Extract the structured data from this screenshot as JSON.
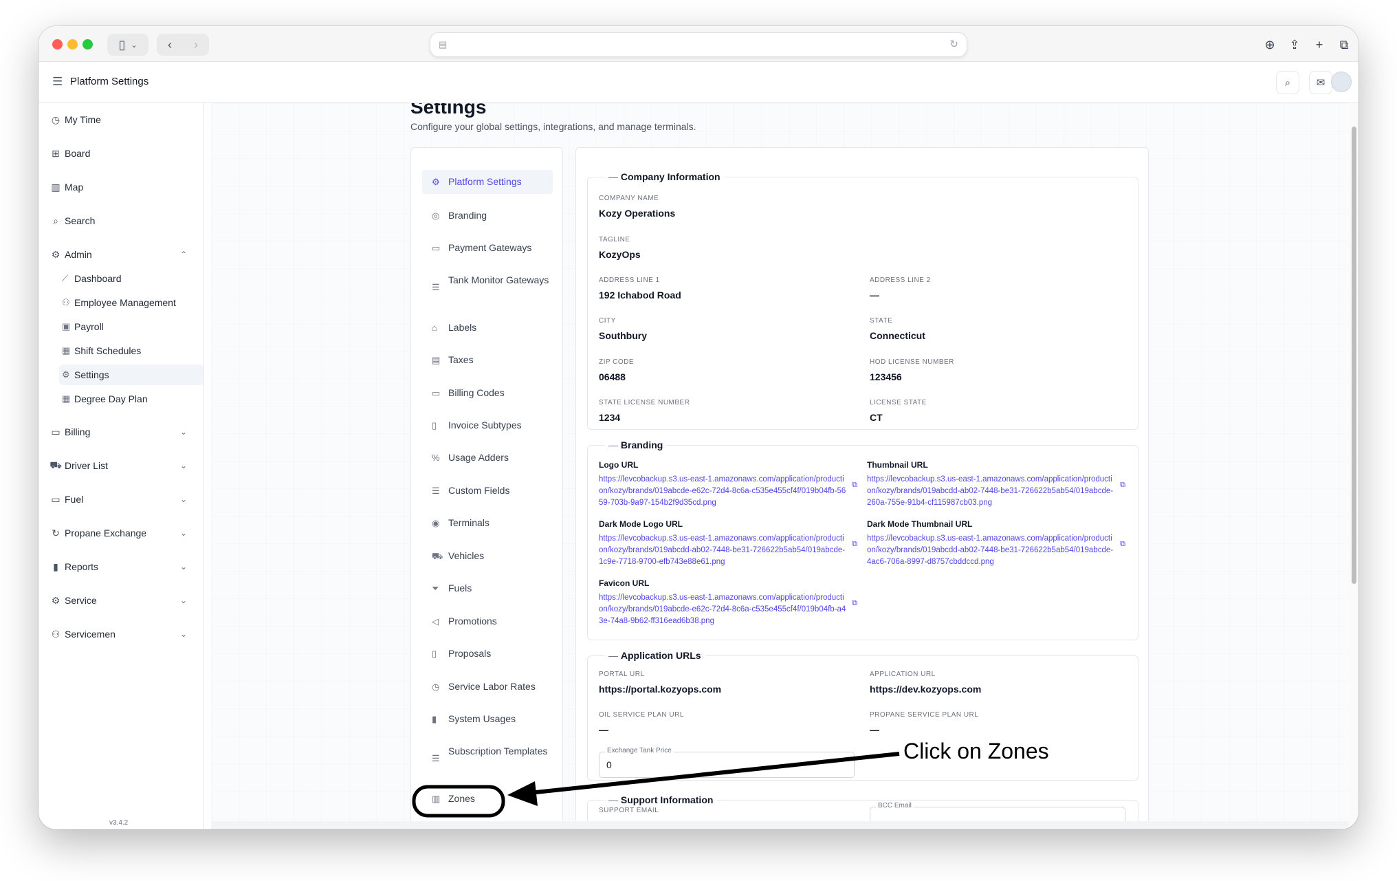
{
  "app": {
    "header_title": "Platform Settings",
    "version": "v3.4.2"
  },
  "nav": {
    "items": [
      {
        "label": "My Time",
        "icon": "clock-icon"
      },
      {
        "label": "Board",
        "icon": "grid-icon"
      },
      {
        "label": "Map",
        "icon": "map-icon"
      },
      {
        "label": "Search",
        "icon": "search-icon"
      },
      {
        "label": "Admin",
        "icon": "gear-icon"
      }
    ],
    "admin_sub": [
      {
        "label": "Dashboard",
        "icon": "chart-icon"
      },
      {
        "label": "Employee Management",
        "icon": "users-icon"
      },
      {
        "label": "Payroll",
        "icon": "money-icon"
      },
      {
        "label": "Shift Schedules",
        "icon": "calendar-icon"
      },
      {
        "label": "Settings",
        "icon": "gear-icon"
      },
      {
        "label": "Degree Day Plan",
        "icon": "calendar-icon"
      }
    ],
    "groups": [
      {
        "label": "Billing",
        "icon": "receipt-icon"
      },
      {
        "label": "Driver List",
        "icon": "truck-icon"
      },
      {
        "label": "Fuel",
        "icon": "folder-icon"
      },
      {
        "label": "Propane Exchange",
        "icon": "refresh-icon"
      },
      {
        "label": "Reports",
        "icon": "bar-chart-icon"
      },
      {
        "label": "Service",
        "icon": "gear-icon"
      },
      {
        "label": "Servicemen",
        "icon": "users-icon"
      }
    ]
  },
  "page": {
    "title": "Settings",
    "subtitle": "Configure your global settings, integrations, and manage terminals."
  },
  "settings_menu": [
    {
      "label": "Platform Settings",
      "icon": "gear-icon",
      "active": true
    },
    {
      "label": "Branding",
      "icon": "palette-icon"
    },
    {
      "label": "Payment Gateways",
      "icon": "card-icon"
    },
    {
      "label": "Tank Monitor Gateways",
      "icon": "list-icon"
    },
    {
      "label": "Labels",
      "icon": "tag-icon"
    },
    {
      "label": "Taxes",
      "icon": "document-icon"
    },
    {
      "label": "Billing Codes",
      "icon": "card-icon"
    },
    {
      "label": "Invoice Subtypes",
      "icon": "file-icon"
    },
    {
      "label": "Usage Adders",
      "icon": "percent-icon"
    },
    {
      "label": "Custom Fields",
      "icon": "list-icon"
    },
    {
      "label": "Terminals",
      "icon": "pin-icon"
    },
    {
      "label": "Vehicles",
      "icon": "truck-icon"
    },
    {
      "label": "Fuels",
      "icon": "filter-icon"
    },
    {
      "label": "Promotions",
      "icon": "megaphone-icon"
    },
    {
      "label": "Proposals",
      "icon": "file-icon"
    },
    {
      "label": "Service Labor Rates",
      "icon": "clock-icon"
    },
    {
      "label": "System Usages",
      "icon": "bar-chart-icon"
    },
    {
      "label": "Subscription Templates",
      "icon": "list-icon"
    },
    {
      "label": "Zones",
      "icon": "map-icon"
    }
  ],
  "company": {
    "section_title": "Company Information",
    "company_name_label": "COMPANY NAME",
    "company_name": "Kozy Operations",
    "tagline_label": "TAGLINE",
    "tagline": "KozyOps",
    "address1_label": "ADDRESS LINE 1",
    "address1": "192 Ichabod Road",
    "address2_label": "ADDRESS LINE 2",
    "address2": "—",
    "city_label": "CITY",
    "city": "Southbury",
    "state_label": "STATE",
    "state": "Connecticut",
    "zip_label": "ZIP CODE",
    "zip": "06488",
    "hod_label": "HOD LICENSE NUMBER",
    "hod": "123456",
    "state_license_label": "STATE LICENSE NUMBER",
    "state_license": "1234",
    "license_state_label": "LICENSE STATE",
    "license_state": "CT"
  },
  "branding": {
    "section_title": "Branding",
    "logo_label": "Logo URL",
    "logo_url": "https://levcobackup.s3.us-east-1.amazonaws.com/application/production/kozy/brands/019abcde-e62c-72d4-8c6a-c535e455cf4f/019b04fb-5659-703b-9a97-154b2f9d35cd.png",
    "thumb_label": "Thumbnail URL",
    "thumb_url": "https://levcobackup.s3.us-east-1.amazonaws.com/application/production/kozy/brands/019abcdd-ab02-7448-be31-726622b5ab54/019abcde-260a-755e-91b4-cf115987cb03.png",
    "dark_logo_label": "Dark Mode Logo URL",
    "dark_logo_url": "https://levcobackup.s3.us-east-1.amazonaws.com/application/production/kozy/brands/019abcdd-ab02-7448-be31-726622b5ab54/019abcde-1c9e-7718-9700-efb743e88e61.png",
    "dark_thumb_label": "Dark Mode Thumbnail URL",
    "dark_thumb_url": "https://levcobackup.s3.us-east-1.amazonaws.com/application/production/kozy/brands/019abcdd-ab02-7448-be31-726622b5ab54/019abcde-4ac6-706a-8997-d8757cbddccd.png",
    "favicon_label": "Favicon URL",
    "favicon_url": "https://levcobackup.s3.us-east-1.amazonaws.com/application/production/kozy/brands/019abcde-e62c-72d4-8c6a-c535e455cf4f/019b04fb-a43e-74a8-9b62-ff316ead6b38.png"
  },
  "app_urls": {
    "section_title": "Application URLs",
    "portal_label": "PORTAL URL",
    "portal": "https://portal.kozyops.com",
    "app_label": "APPLICATION URL",
    "app": "https://dev.kozyops.com",
    "oil_label": "OIL SERVICE PLAN URL",
    "oil": "—",
    "propane_label": "PROPANE SERVICE PLAN URL",
    "propane": "—",
    "exchange_label": "Exchange Tank Price",
    "exchange_value": "0"
  },
  "support": {
    "section_title": "Support Information",
    "email_label": "SUPPORT EMAIL",
    "bcc_label": "BCC Email"
  },
  "annotation": {
    "text": "Click on Zones"
  },
  "colors": {
    "accent": "#4f46e5",
    "active_bg": "#f1f5f9"
  }
}
